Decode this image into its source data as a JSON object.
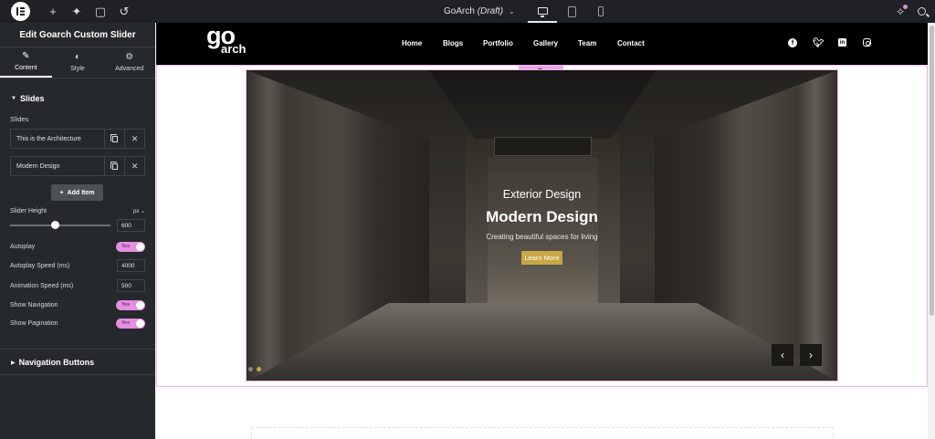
{
  "editor": {
    "document_name": "GoArch",
    "document_state": "(Draft)",
    "panel_title": "Edit Goarch Custom Slider",
    "tabs": [
      {
        "label": "Content"
      },
      {
        "label": "Style"
      },
      {
        "label": "Advanced"
      }
    ],
    "section_slides": "Slides",
    "slides_label": "Slides",
    "slide_items": [
      {
        "title": "This is the Architecture"
      },
      {
        "title": "Modern Design"
      }
    ],
    "add_item": "Add Item",
    "slider_height_label": "Slider Height",
    "slider_height_unit": "px",
    "slider_height_value": "600",
    "slider_height_fraction": 0.45,
    "autoplay_label": "Autoplay",
    "autoplay_value": "Yes",
    "autoplay_speed_label": "Autoplay Speed (ms)",
    "autoplay_speed_value": "4000",
    "animation_speed_label": "Animation Speed (ms)",
    "animation_speed_value": "500",
    "show_navigation_label": "Show Navigation",
    "show_navigation_value": "Yes",
    "show_pagination_label": "Show Pagination",
    "show_pagination_value": "Yes",
    "section_nav_buttons": "Navigation Buttons"
  },
  "site": {
    "logo_go": "go",
    "logo_arch": "arch",
    "nav": [
      "Home",
      "Blogs",
      "Portfolio",
      "Gallery",
      "Team",
      "Contact"
    ],
    "socials": [
      "facebook-icon",
      "twitter-icon",
      "linkedin-icon",
      "instagram-icon"
    ]
  },
  "slide": {
    "subtitle": "Exterior Design",
    "title": "Modern Design",
    "description": "Creating beautiful spaces for living",
    "button": "Learn More",
    "prev": "‹",
    "next": "›",
    "active_dot_color": "#c9a646"
  },
  "colors": {
    "editor_dark": "#26292c",
    "accent_pink": "#e58ee2",
    "cta_gold": "#c9a646"
  }
}
